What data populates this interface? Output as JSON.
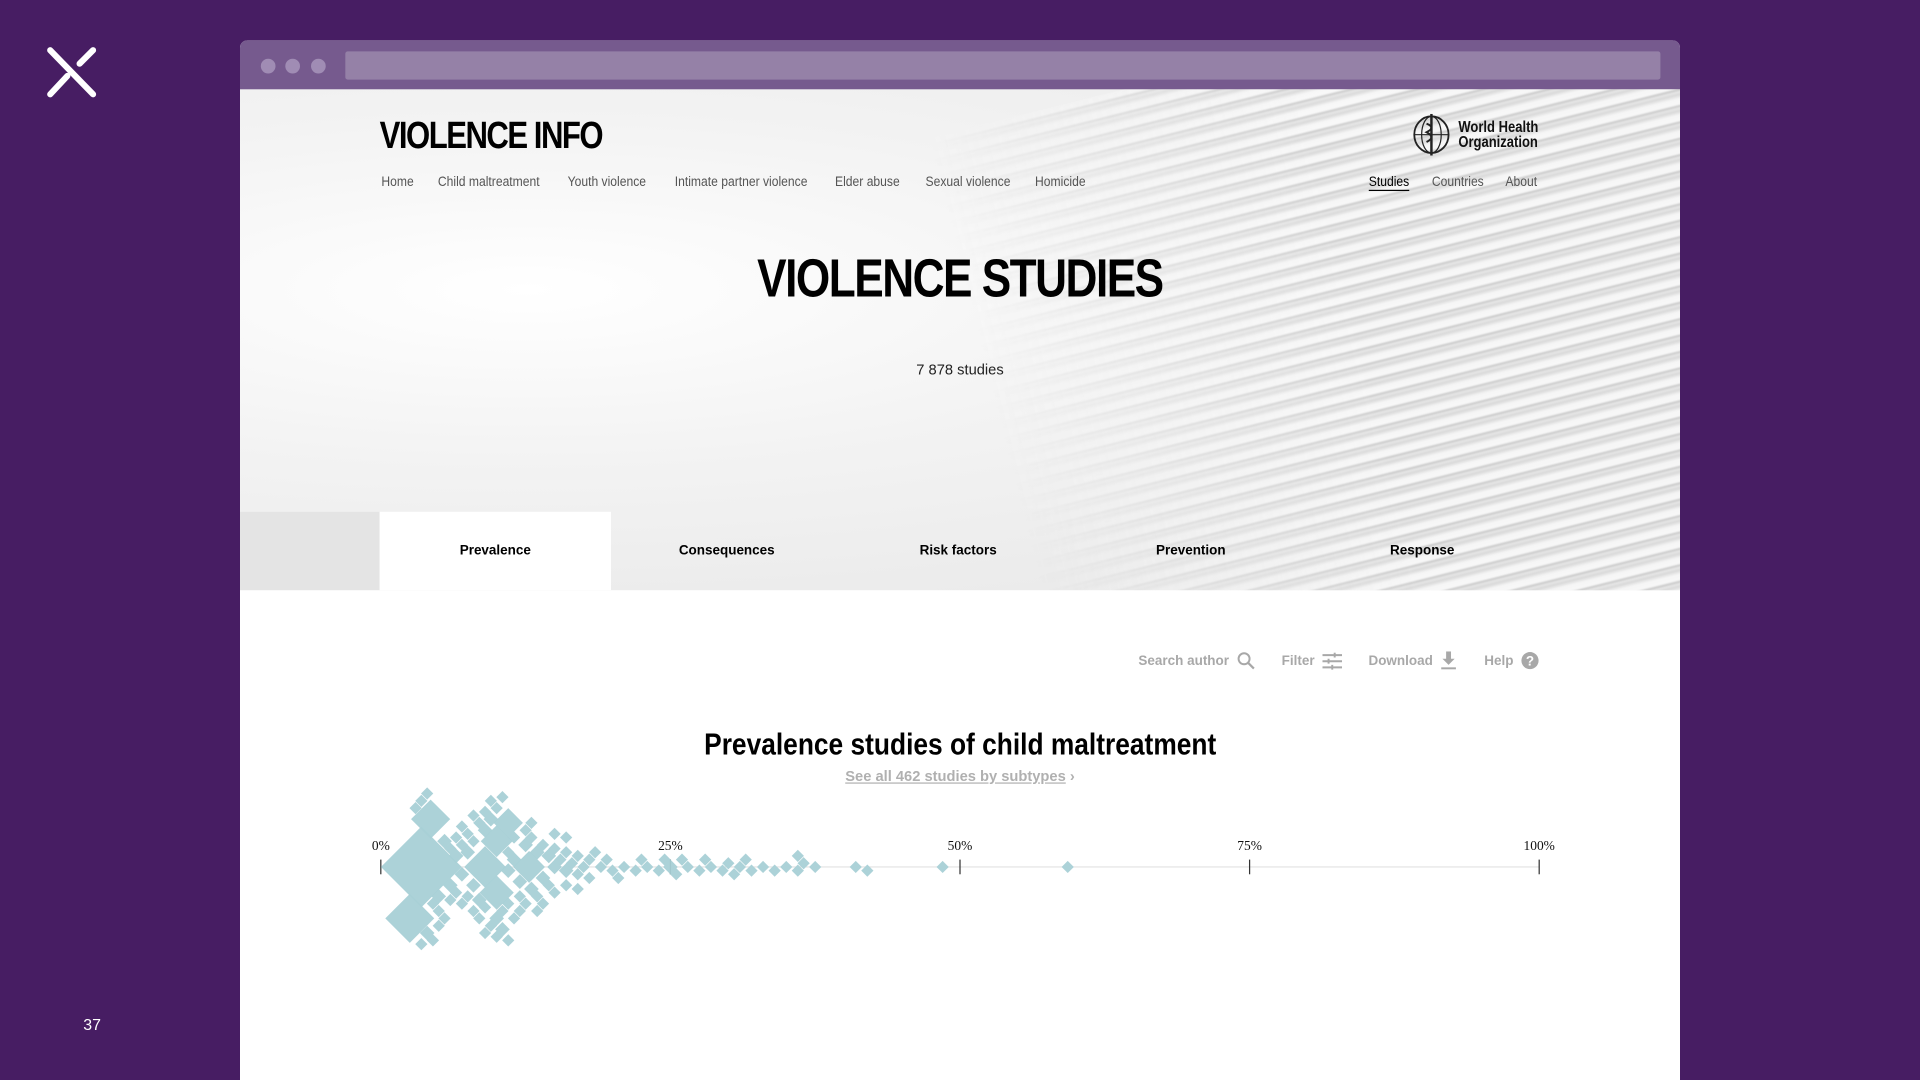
{
  "slide": {
    "number": "37",
    "logo": "x-logo"
  },
  "site": {
    "title": "VIOLENCE INFO",
    "org_logo_text": "World Health Organization",
    "org_line1": "World Health",
    "org_line2": "Organization",
    "nav_left": [
      "Home",
      "Child maltreatment",
      "Youth violence",
      "Intimate partner violence",
      "Elder abuse",
      "Sexual violence",
      "Homicide"
    ],
    "nav_right": [
      "Studies",
      "Countries",
      "About"
    ],
    "nav_active": "Studies"
  },
  "hero": {
    "title": "VIOLENCE STUDIES",
    "subtitle": "7 878 studies"
  },
  "tabs": [
    {
      "label": "Prevalence",
      "active": true
    },
    {
      "label": "Consequences",
      "active": false
    },
    {
      "label": "Risk factors",
      "active": false
    },
    {
      "label": "Prevention",
      "active": false
    },
    {
      "label": "Response",
      "active": false
    }
  ],
  "tools": {
    "search": "Search author",
    "filter": "Filter",
    "download": "Download",
    "help": "Help"
  },
  "chart_section": {
    "title": "Prevalence studies of child maltreatment",
    "link": "See all 462 studies by subtypes",
    "link_icon": "chevron-right"
  },
  "colors": {
    "background": "#471d63",
    "chrome": "#765a8e",
    "marker": "#a8d0d6",
    "muted_text": "#a8a8a8"
  },
  "chart_data": {
    "type": "scatter",
    "subtype": "beeswarm",
    "marker": "diamond",
    "xlim": [
      0,
      100
    ],
    "ticks": [
      "0%",
      "25%",
      "50%",
      "75%",
      "100%"
    ],
    "tick_values": [
      0,
      25,
      50,
      75,
      100
    ],
    "points": [
      {
        "x": 3.5,
        "w": 33
      },
      {
        "x": 2.5,
        "w": 20
      },
      {
        "x": 4.3,
        "w": 16
      },
      {
        "x": 9,
        "w": 17
      },
      {
        "x": 10,
        "w": 14
      },
      {
        "x": 12.8,
        "w": 13
      },
      {
        "x": 10,
        "w": 13
      },
      {
        "x": 11,
        "w": 12
      },
      {
        "x": 3,
        "w": 5
      },
      {
        "x": 3.5,
        "w": 5
      },
      {
        "x": 4,
        "w": 5
      },
      {
        "x": 4.5,
        "w": 5
      },
      {
        "x": 5,
        "w": 5
      },
      {
        "x": 5.5,
        "w": 5
      },
      {
        "x": 6,
        "w": 5
      },
      {
        "x": 6.5,
        "w": 5
      },
      {
        "x": 7,
        "w": 5
      },
      {
        "x": 7.5,
        "w": 5
      },
      {
        "x": 8,
        "w": 5
      },
      {
        "x": 8.5,
        "w": 5
      },
      {
        "x": 9,
        "w": 5
      },
      {
        "x": 9.5,
        "w": 5
      },
      {
        "x": 10.5,
        "w": 5
      },
      {
        "x": 11,
        "w": 5
      },
      {
        "x": 11.5,
        "w": 5
      },
      {
        "x": 12,
        "w": 5
      },
      {
        "x": 12.5,
        "w": 5
      },
      {
        "x": 13,
        "w": 5
      },
      {
        "x": 13.5,
        "w": 5
      },
      {
        "x": 14,
        "w": 5
      },
      {
        "x": 14.5,
        "w": 5
      },
      {
        "x": 15,
        "w": 5
      },
      {
        "x": 15.5,
        "w": 5
      },
      {
        "x": 16,
        "w": 5
      },
      {
        "x": 16.5,
        "w": 5
      },
      {
        "x": 17,
        "w": 5
      },
      {
        "x": 17.5,
        "w": 5
      },
      {
        "x": 18,
        "w": 5
      },
      {
        "x": 19,
        "w": 5
      },
      {
        "x": 20,
        "w": 5
      },
      {
        "x": 4,
        "w": 6
      },
      {
        "x": 5,
        "w": 6
      },
      {
        "x": 6,
        "w": 6
      },
      {
        "x": 7,
        "w": 6
      },
      {
        "x": 8,
        "w": 6
      },
      {
        "x": 9,
        "w": 6
      },
      {
        "x": 10,
        "w": 6
      },
      {
        "x": 11,
        "w": 6
      },
      {
        "x": 12,
        "w": 6
      },
      {
        "x": 13,
        "w": 6
      },
      {
        "x": 14,
        "w": 6
      },
      {
        "x": 15,
        "w": 6
      },
      {
        "x": 16,
        "w": 6
      },
      {
        "x": 5.5,
        "w": 6
      },
      {
        "x": 6.5,
        "w": 6
      },
      {
        "x": 7.5,
        "w": 6
      },
      {
        "x": 8.5,
        "w": 6
      },
      {
        "x": 9.5,
        "w": 6
      },
      {
        "x": 10.5,
        "w": 6
      },
      {
        "x": 11.5,
        "w": 6
      },
      {
        "x": 12.5,
        "w": 6
      },
      {
        "x": 13.5,
        "w": 6
      },
      {
        "x": 14.5,
        "w": 6
      },
      {
        "x": 7,
        "w": 5
      },
      {
        "x": 8,
        "w": 5
      },
      {
        "x": 9,
        "w": 5
      },
      {
        "x": 10,
        "w": 5
      },
      {
        "x": 11,
        "w": 5
      },
      {
        "x": 12,
        "w": 5
      },
      {
        "x": 13,
        "w": 5
      },
      {
        "x": 6,
        "w": 5
      },
      {
        "x": 5,
        "w": 5
      },
      {
        "x": 14,
        "w": 5
      },
      {
        "x": 15,
        "w": 5
      },
      {
        "x": 16,
        "w": 5
      },
      {
        "x": 17,
        "w": 5
      },
      {
        "x": 18,
        "w": 5
      },
      {
        "x": 6.5,
        "w": 5
      },
      {
        "x": 7.5,
        "w": 5
      },
      {
        "x": 8.5,
        "w": 5
      },
      {
        "x": 9.5,
        "w": 5
      },
      {
        "x": 10.5,
        "w": 5
      },
      {
        "x": 11.5,
        "w": 5
      },
      {
        "x": 12.5,
        "w": 5
      },
      {
        "x": 13.5,
        "w": 5
      },
      {
        "x": 4.5,
        "w": 5
      },
      {
        "x": 3.5,
        "w": 5
      },
      {
        "x": 8,
        "w": 5
      },
      {
        "x": 9,
        "w": 5
      },
      {
        "x": 10,
        "w": 5
      },
      {
        "x": 7,
        "w": 5
      },
      {
        "x": 11,
        "w": 5
      },
      {
        "x": 21,
        "w": 5
      },
      {
        "x": 22,
        "w": 5
      },
      {
        "x": 23,
        "w": 5
      },
      {
        "x": 24,
        "w": 5
      },
      {
        "x": 25,
        "w": 6
      },
      {
        "x": 25.5,
        "w": 5
      },
      {
        "x": 26.5,
        "w": 5
      },
      {
        "x": 27.5,
        "w": 5
      },
      {
        "x": 28.5,
        "w": 5
      },
      {
        "x": 29.5,
        "w": 5
      },
      {
        "x": 30,
        "w": 5
      },
      {
        "x": 30.5,
        "w": 5
      },
      {
        "x": 31,
        "w": 5
      },
      {
        "x": 32,
        "w": 5
      },
      {
        "x": 33,
        "w": 5
      },
      {
        "x": 34,
        "w": 5
      },
      {
        "x": 35,
        "w": 5
      },
      {
        "x": 36,
        "w": 5
      },
      {
        "x": 36.5,
        "w": 5
      },
      {
        "x": 37.5,
        "w": 5
      },
      {
        "x": 41,
        "w": 5
      },
      {
        "x": 42,
        "w": 5
      },
      {
        "x": 48.5,
        "w": 5
      },
      {
        "x": 59.3,
        "w": 5
      },
      {
        "x": 19.5,
        "w": 5
      },
      {
        "x": 20.5,
        "w": 5
      },
      {
        "x": 22.5,
        "w": 5
      },
      {
        "x": 26,
        "w": 5
      },
      {
        "x": 28,
        "w": 5
      },
      {
        "x": 31.5,
        "w": 5
      },
      {
        "x": 36,
        "w": 5
      },
      {
        "x": 24.5,
        "w": 5
      },
      {
        "x": 18.5,
        "w": 5
      },
      {
        "x": 17,
        "w": 5
      },
      {
        "x": 16,
        "w": 5
      },
      {
        "x": 15,
        "w": 5
      }
    ]
  }
}
